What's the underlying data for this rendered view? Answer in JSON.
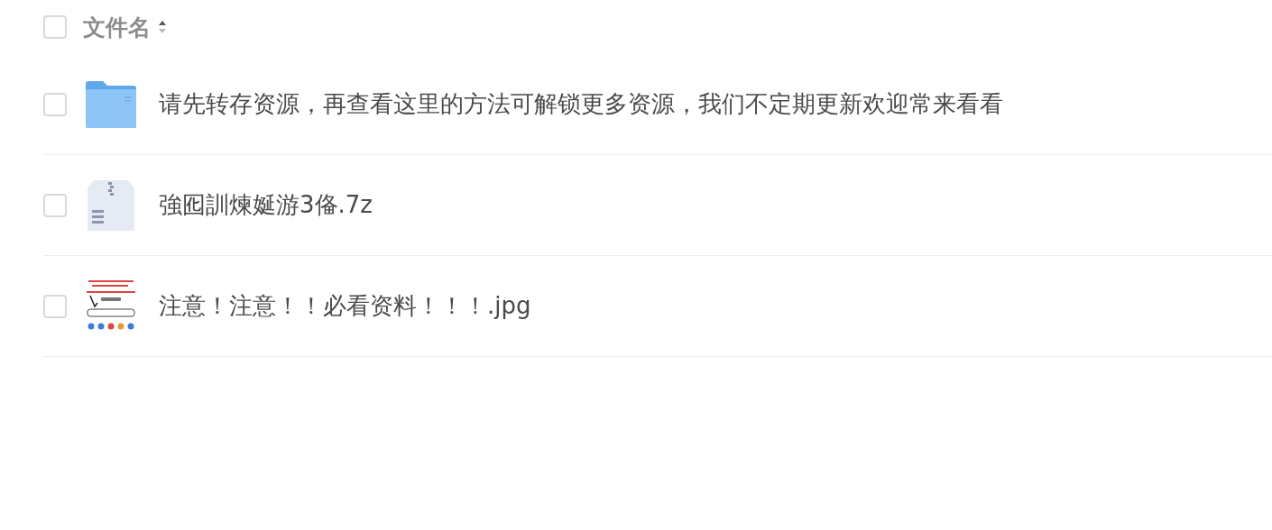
{
  "header": {
    "checked": false,
    "label": "文件名",
    "sort_ascending": true
  },
  "files": [
    {
      "kind": "folder",
      "checked": false,
      "name": "请先转存资源，再查看这里的方法可解锁更多资源，我们不定期更新欢迎常来看看"
    },
    {
      "kind": "archive",
      "checked": false,
      "name": "強囮訓煉娫游3俻.7z"
    },
    {
      "kind": "picture",
      "checked": false,
      "name": "注意！注意！！必看资料！！！.jpg"
    }
  ]
}
